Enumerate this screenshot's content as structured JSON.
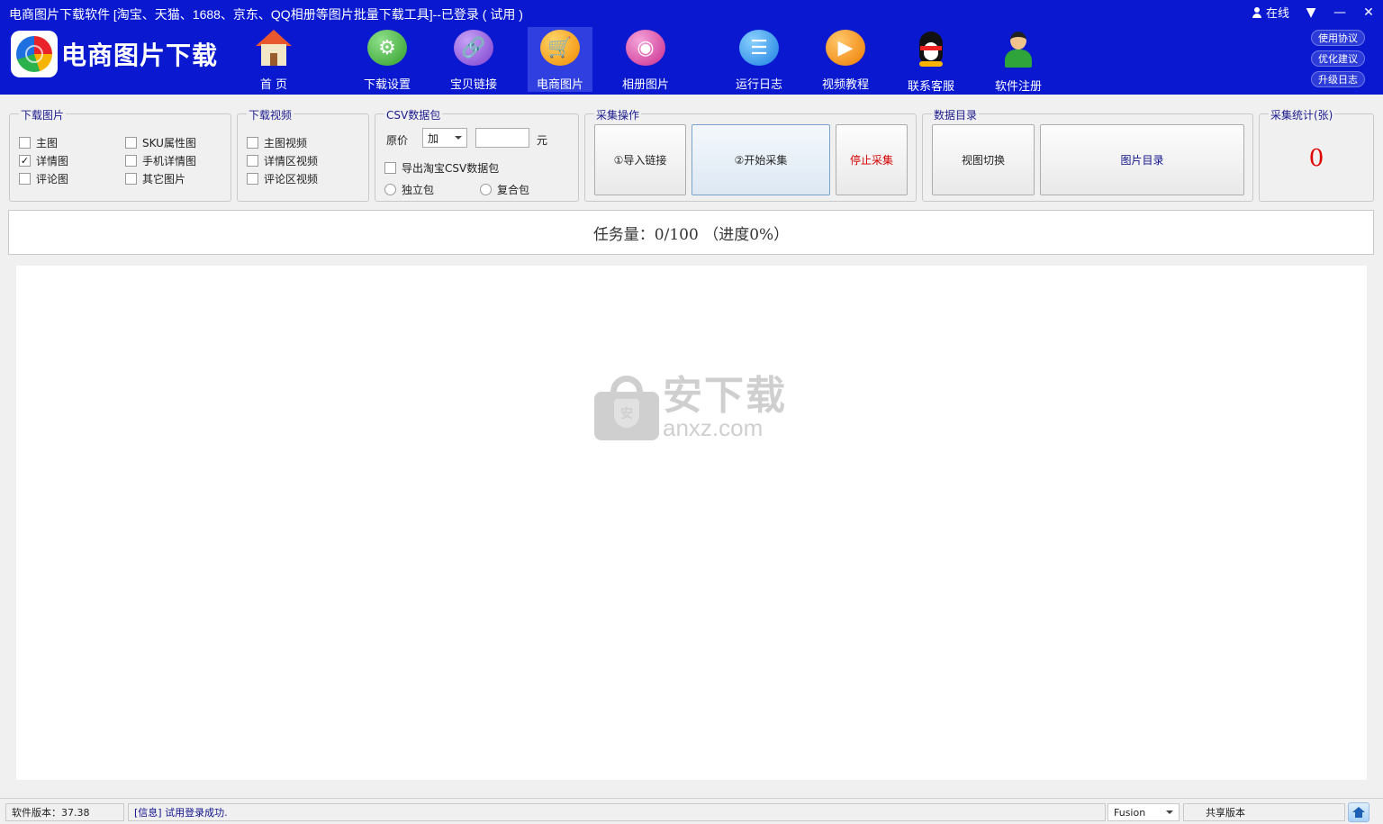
{
  "window": {
    "title": "电商图片下载软件 [淘宝、天猫、1688、京东、QQ相册等图片批量下载工具]--已登录 ( 试用 )",
    "online_label": "在线",
    "collapse_glyph": "▼",
    "minimize_glyph": "—",
    "close_glyph": "✕"
  },
  "logo": {
    "text": "电商图片下载"
  },
  "toolbar": {
    "items": [
      {
        "label": "首 页",
        "icon": "home-icon"
      },
      {
        "label": "下载设置",
        "icon": "gear-icon"
      },
      {
        "label": "宝贝链接",
        "icon": "link-icon"
      },
      {
        "label": "电商图片",
        "icon": "cart-icon",
        "active": true
      },
      {
        "label": "相册图片",
        "icon": "album-icon"
      },
      {
        "label": "运行日志",
        "icon": "log-icon"
      },
      {
        "label": "视频教程",
        "icon": "play-icon"
      },
      {
        "label": "联系客服",
        "icon": "qq-icon"
      },
      {
        "label": "软件注册",
        "icon": "user-register-icon"
      }
    ],
    "glyphs": {
      "settings": "⚙",
      "link": "🔗",
      "cart": "🛒",
      "album": "◉",
      "log": "☰",
      "video": "▶"
    }
  },
  "side_buttons": {
    "agreement": "使用协议",
    "suggest": "优化建议",
    "upgrade_log": "升级日志"
  },
  "download_images": {
    "title": "下载图片",
    "main": {
      "label": "主图",
      "checked": false
    },
    "sku": {
      "label": "SKU属性图",
      "checked": false
    },
    "detail": {
      "label": "详情图",
      "checked": true,
      "mark": "✓"
    },
    "mobile_detail": {
      "label": "手机详情图",
      "checked": false
    },
    "review": {
      "label": "评论图",
      "checked": false
    },
    "other": {
      "label": "其它图片",
      "checked": false
    }
  },
  "download_video": {
    "title": "下载视频",
    "main": {
      "label": "主图视频",
      "checked": false
    },
    "detail": {
      "label": "详情区视频",
      "checked": false
    },
    "review": {
      "label": "评论区视频",
      "checked": false
    }
  },
  "csv": {
    "title": "CSV数据包",
    "price_label": "原价",
    "op_value": "加",
    "amount_value": "",
    "unit": "元",
    "export_label": "导出淘宝CSV数据包",
    "export_checked": false,
    "radio_single": "独立包",
    "radio_combined": "复合包"
  },
  "collect": {
    "title": "采集操作",
    "import_label": "①导入链接",
    "start_label": "②开始采集",
    "stop_label": "停止采集"
  },
  "data_dir": {
    "title": "数据目录",
    "switch_label": "视图切换",
    "image_dir_label": "图片目录"
  },
  "stats": {
    "title": "采集统计(张)",
    "count": "0"
  },
  "progress": {
    "text": "任务量：0/100 （进度0%）"
  },
  "watermark": {
    "cn": "安下载",
    "en": "anxz.com",
    "shield_char": "安"
  },
  "statusbar": {
    "version": "软件版本：37.38",
    "info": "[信息] 试用登录成功.",
    "theme_value": "Fusion",
    "edition": "共享版本"
  },
  "colors": {
    "titlebar": "#0a18d0",
    "accent_red": "#e00000",
    "label_blue": "#1a1a8c"
  }
}
